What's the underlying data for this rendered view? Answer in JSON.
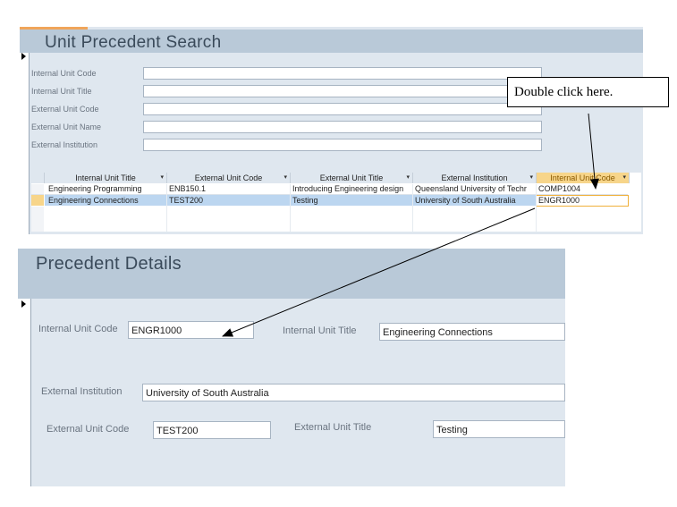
{
  "search_form": {
    "title": "Unit Precedent Search",
    "fields": [
      {
        "label": "Internal Unit Code",
        "value": ""
      },
      {
        "label": "Internal Unit Title",
        "value": ""
      },
      {
        "label": "External Unit Code",
        "value": ""
      },
      {
        "label": "External Unit Name",
        "value": ""
      },
      {
        "label": "External Institution",
        "value": ""
      }
    ],
    "columns": [
      "Internal Unit Title",
      "External Unit Code",
      "External Unit Title",
      "External Institution",
      "Internal Unit Code"
    ],
    "rows": [
      [
        "Engineering Programming",
        "ENB150.1",
        "Introducing Engineering design",
        "Queensland University of Techr",
        "COMP1004"
      ],
      [
        "Engineering Connections",
        "TEST200",
        "Testing",
        "University of South Australia",
        "ENGR1000"
      ]
    ]
  },
  "callout": {
    "text": "Double click here."
  },
  "details_form": {
    "title": "Precedent Details",
    "internal_unit_code_label": "Internal Unit Code",
    "internal_unit_code_value": "ENGR1000",
    "internal_unit_title_label": "Internal Unit Title",
    "internal_unit_title_value": "Engineering Connections",
    "external_institution_label": "External Institution",
    "external_institution_value": "University of South Australia",
    "external_unit_code_label": "External Unit Code",
    "external_unit_code_value": "TEST200",
    "external_unit_title_label": "External Unit Title",
    "external_unit_title_value": "Testing"
  },
  "colors": {
    "header": "#b9c9d8",
    "form_bg": "#dfe7ef",
    "highlight_header": "#f7d58a",
    "selected_row": "#bcd6f0"
  }
}
